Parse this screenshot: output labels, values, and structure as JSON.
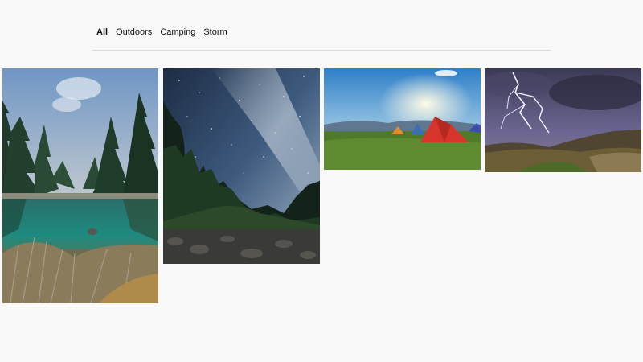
{
  "filters": {
    "tabs": [
      {
        "label": "All",
        "active": true
      },
      {
        "label": "Outdoors",
        "active": false
      },
      {
        "label": "Camping",
        "active": false
      },
      {
        "label": "Storm",
        "active": false
      }
    ]
  },
  "gallery": {
    "photos": [
      {
        "subject": "mountain lake with pine forest"
      },
      {
        "subject": "milky way night sky over mountains"
      },
      {
        "subject": "tents on a meadow at sunset"
      },
      {
        "subject": "lightning storm over hills"
      }
    ]
  },
  "colors": {
    "background": "#f9f9f9",
    "divider": "#dcdcdc",
    "text": "#111111"
  }
}
